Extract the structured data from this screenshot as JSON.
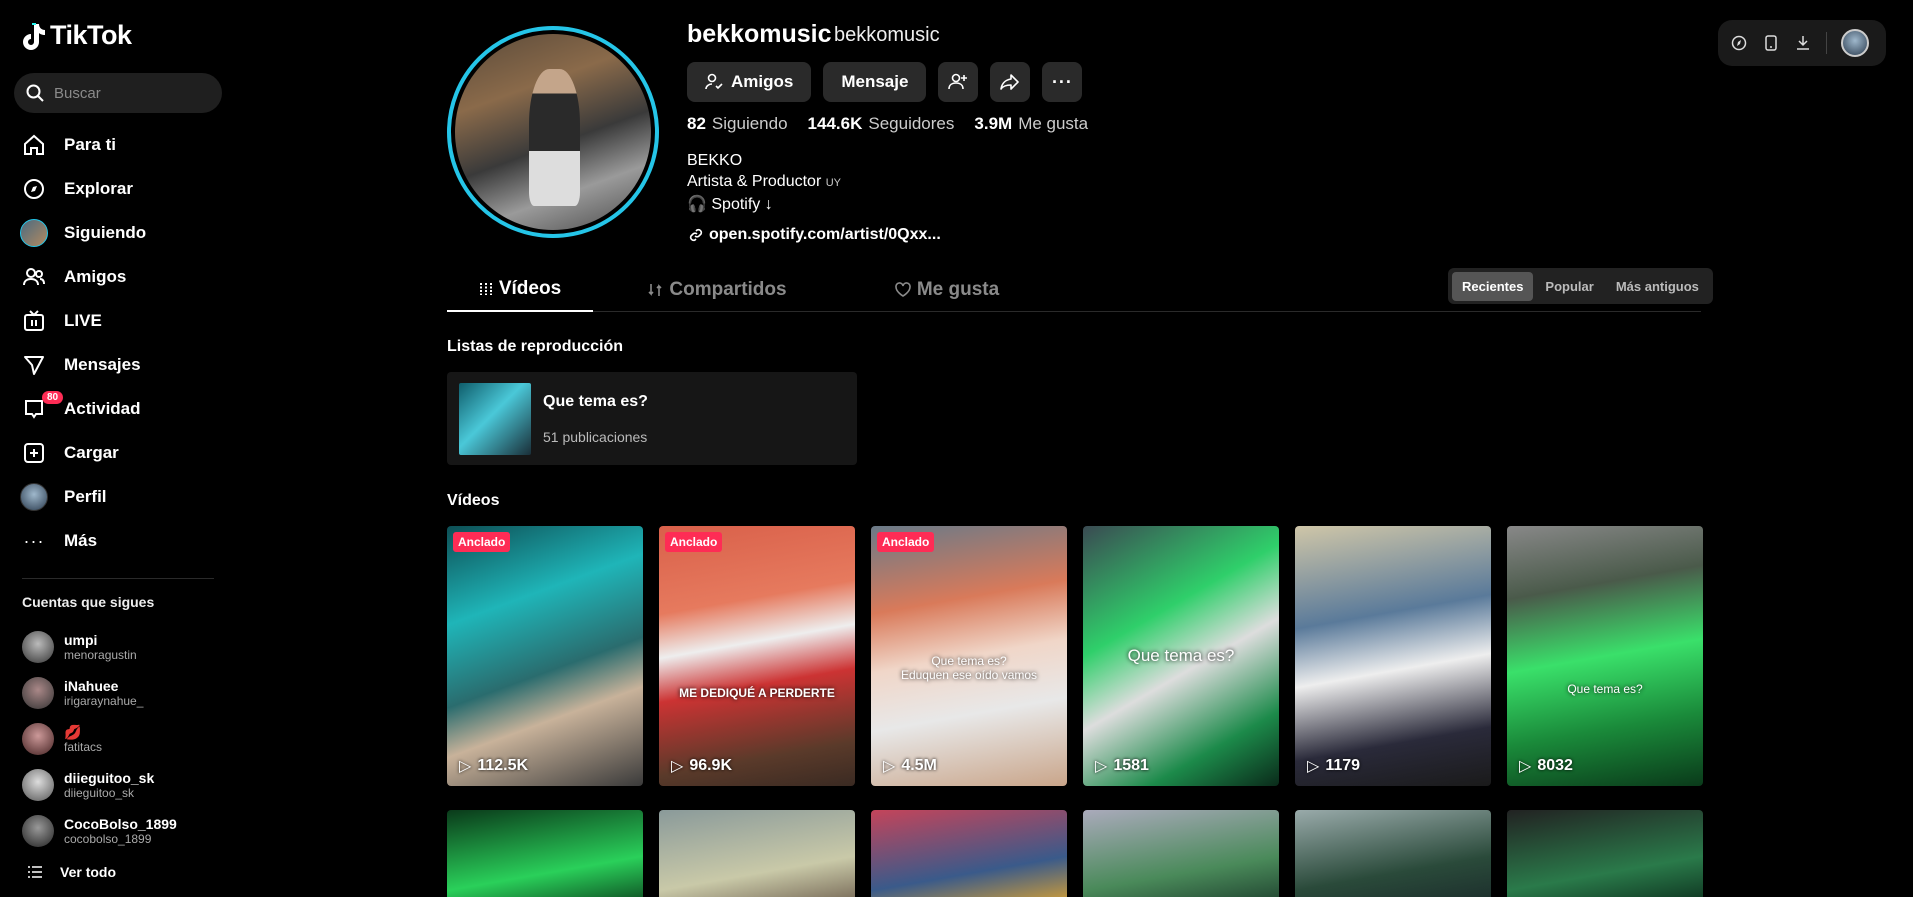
{
  "app": {
    "logo_text": "TikTok"
  },
  "search": {
    "placeholder": "Buscar"
  },
  "nav": [
    {
      "label": "Para ti",
      "icon": "home-icon"
    },
    {
      "label": "Explorar",
      "icon": "compass-icon"
    },
    {
      "label": "Siguiendo",
      "icon": "following-avatar"
    },
    {
      "label": "Amigos",
      "icon": "friends-icon"
    },
    {
      "label": "LIVE",
      "icon": "live-icon"
    },
    {
      "label": "Mensajes",
      "icon": "send-icon"
    },
    {
      "label": "Actividad",
      "icon": "inbox-icon",
      "badge": "80"
    },
    {
      "label": "Cargar",
      "icon": "plus-square-icon"
    },
    {
      "label": "Perfil",
      "icon": "profile-avatar"
    },
    {
      "label": "Más",
      "icon": "more-dots-icon"
    }
  ],
  "following": {
    "title": "Cuentas que sigues",
    "accounts": [
      {
        "name": "umpi",
        "handle": "menoragustin"
      },
      {
        "name": "iNahuee",
        "handle": "irigaraynahue_"
      },
      {
        "name": "💋",
        "handle": "fatitacs"
      },
      {
        "name": "diieguitoo_sk",
        "handle": "diieguitoo_sk"
      },
      {
        "name": "CocoBolso_1899",
        "handle": "cocobolso_1899"
      }
    ],
    "see_all": "Ver todo"
  },
  "profile": {
    "username": "bekkomusic",
    "nickname": "bekkomusic",
    "buttons": {
      "friends": "Amigos",
      "message": "Mensaje"
    },
    "stats": {
      "following_count": "82",
      "following_label": "Siguiendo",
      "followers_count": "144.6K",
      "followers_label": "Seguidores",
      "likes_count": "3.9M",
      "likes_label": "Me gusta"
    },
    "bio": {
      "line1": "BEKKO",
      "line2": "Artista & Productor",
      "line2_suffix": "UY",
      "line3": "🎧 Spotify ↓"
    },
    "link": "open.spotify.com/artist/0Qxx..."
  },
  "tabs": [
    {
      "label": "Vídeos",
      "active": true
    },
    {
      "label": "Compartidos",
      "active": false
    },
    {
      "label": "Me gusta",
      "active": false
    }
  ],
  "sort": [
    "Recientes",
    "Popular",
    "Más antiguos"
  ],
  "playlists": {
    "title": "Listas de reproducción",
    "items": [
      {
        "title": "Que tema es?",
        "count": "51 publicaciones"
      }
    ]
  },
  "videos": {
    "title": "Vídeos",
    "pinned_label": "Anclado",
    "items": [
      {
        "views": "112.5K",
        "pinned": true,
        "caption": ""
      },
      {
        "views": "96.9K",
        "pinned": true,
        "caption": "ME DEDIQUÉ A PERDERTE"
      },
      {
        "views": "4.5M",
        "pinned": true,
        "caption": "Que tema es?\nEduquen ese oído vamos"
      },
      {
        "views": "1581",
        "pinned": false,
        "caption": "Que tema es?"
      },
      {
        "views": "1179",
        "pinned": false,
        "caption": ""
      },
      {
        "views": "8032",
        "pinned": false,
        "caption": "Que tema es?"
      }
    ]
  },
  "colors": {
    "accent": "#fe2c55",
    "ring": "#25c5e8",
    "bg": "#000000"
  }
}
